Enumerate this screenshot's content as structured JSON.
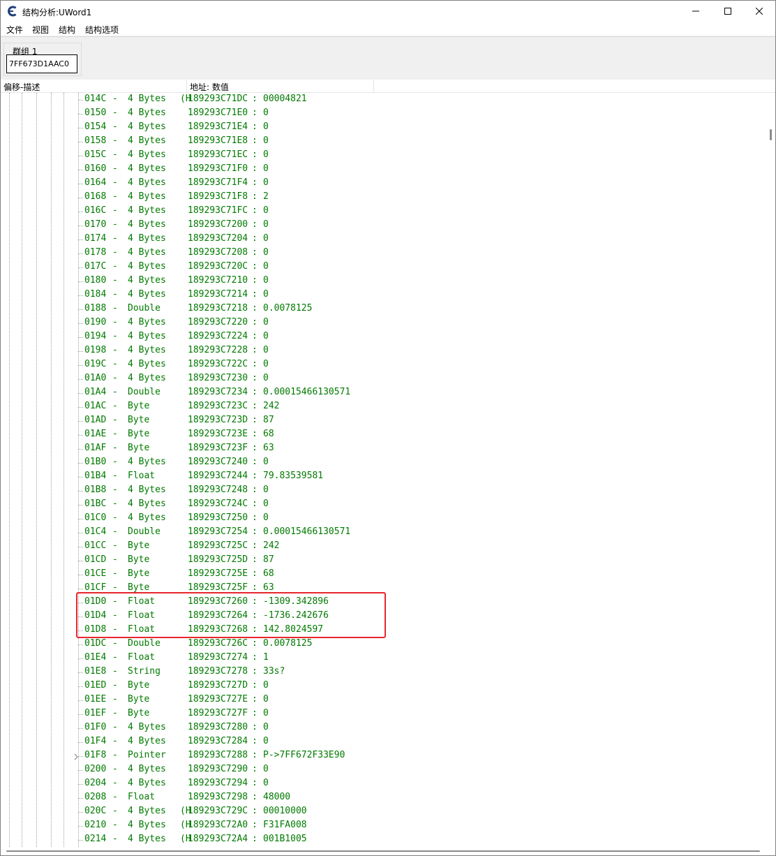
{
  "window": {
    "title": "结构分析:UWord1"
  },
  "menu": [
    "文件",
    "视图",
    "结构",
    "结构选项"
  ],
  "group": {
    "label": "群组 1",
    "address": "7FF673D1AAC0"
  },
  "header": {
    "col1": "偏移-描述",
    "col2": "地址: 数值"
  },
  "rows": [
    {
      "offset": "014C",
      "type": "4 Bytes",
      "hint": "(H",
      "address": "189293C71DC",
      "value": "00004821"
    },
    {
      "offset": "0150",
      "type": "4 Bytes",
      "hint": "",
      "address": "189293C71E0",
      "value": "0"
    },
    {
      "offset": "0154",
      "type": "4 Bytes",
      "hint": "",
      "address": "189293C71E4",
      "value": "0"
    },
    {
      "offset": "0158",
      "type": "4 Bytes",
      "hint": "",
      "address": "189293C71E8",
      "value": "0"
    },
    {
      "offset": "015C",
      "type": "4 Bytes",
      "hint": "",
      "address": "189293C71EC",
      "value": "0"
    },
    {
      "offset": "0160",
      "type": "4 Bytes",
      "hint": "",
      "address": "189293C71F0",
      "value": "0"
    },
    {
      "offset": "0164",
      "type": "4 Bytes",
      "hint": "",
      "address": "189293C71F4",
      "value": "0"
    },
    {
      "offset": "0168",
      "type": "4 Bytes",
      "hint": "",
      "address": "189293C71F8",
      "value": "2"
    },
    {
      "offset": "016C",
      "type": "4 Bytes",
      "hint": "",
      "address": "189293C71FC",
      "value": "0"
    },
    {
      "offset": "0170",
      "type": "4 Bytes",
      "hint": "",
      "address": "189293C7200",
      "value": "0"
    },
    {
      "offset": "0174",
      "type": "4 Bytes",
      "hint": "",
      "address": "189293C7204",
      "value": "0"
    },
    {
      "offset": "0178",
      "type": "4 Bytes",
      "hint": "",
      "address": "189293C7208",
      "value": "0"
    },
    {
      "offset": "017C",
      "type": "4 Bytes",
      "hint": "",
      "address": "189293C720C",
      "value": "0"
    },
    {
      "offset": "0180",
      "type": "4 Bytes",
      "hint": "",
      "address": "189293C7210",
      "value": "0"
    },
    {
      "offset": "0184",
      "type": "4 Bytes",
      "hint": "",
      "address": "189293C7214",
      "value": "0"
    },
    {
      "offset": "0188",
      "type": "Double",
      "hint": "",
      "address": "189293C7218",
      "value": "0.0078125"
    },
    {
      "offset": "0190",
      "type": "4 Bytes",
      "hint": "",
      "address": "189293C7220",
      "value": "0"
    },
    {
      "offset": "0194",
      "type": "4 Bytes",
      "hint": "",
      "address": "189293C7224",
      "value": "0"
    },
    {
      "offset": "0198",
      "type": "4 Bytes",
      "hint": "",
      "address": "189293C7228",
      "value": "0"
    },
    {
      "offset": "019C",
      "type": "4 Bytes",
      "hint": "",
      "address": "189293C722C",
      "value": "0"
    },
    {
      "offset": "01A0",
      "type": "4 Bytes",
      "hint": "",
      "address": "189293C7230",
      "value": "0"
    },
    {
      "offset": "01A4",
      "type": "Double",
      "hint": "",
      "address": "189293C7234",
      "value": "0.00015466130571"
    },
    {
      "offset": "01AC",
      "type": "Byte",
      "hint": "",
      "address": "189293C723C",
      "value": "242"
    },
    {
      "offset": "01AD",
      "type": "Byte",
      "hint": "",
      "address": "189293C723D",
      "value": "87"
    },
    {
      "offset": "01AE",
      "type": "Byte",
      "hint": "",
      "address": "189293C723E",
      "value": "68"
    },
    {
      "offset": "01AF",
      "type": "Byte",
      "hint": "",
      "address": "189293C723F",
      "value": "63"
    },
    {
      "offset": "01B0",
      "type": "4 Bytes",
      "hint": "",
      "address": "189293C7240",
      "value": "0"
    },
    {
      "offset": "01B4",
      "type": "Float",
      "hint": "",
      "address": "189293C7244",
      "value": "79.83539581"
    },
    {
      "offset": "01B8",
      "type": "4 Bytes",
      "hint": "",
      "address": "189293C7248",
      "value": "0"
    },
    {
      "offset": "01BC",
      "type": "4 Bytes",
      "hint": "",
      "address": "189293C724C",
      "value": "0"
    },
    {
      "offset": "01C0",
      "type": "4 Bytes",
      "hint": "",
      "address": "189293C7250",
      "value": "0"
    },
    {
      "offset": "01C4",
      "type": "Double",
      "hint": "",
      "address": "189293C7254",
      "value": "0.00015466130571"
    },
    {
      "offset": "01CC",
      "type": "Byte",
      "hint": "",
      "address": "189293C725C",
      "value": "242"
    },
    {
      "offset": "01CD",
      "type": "Byte",
      "hint": "",
      "address": "189293C725D",
      "value": "87"
    },
    {
      "offset": "01CE",
      "type": "Byte",
      "hint": "",
      "address": "189293C725E",
      "value": "68"
    },
    {
      "offset": "01CF",
      "type": "Byte",
      "hint": "",
      "address": "189293C725F",
      "value": "63"
    },
    {
      "offset": "01D0",
      "type": "Float",
      "hint": "",
      "address": "189293C7260",
      "value": "-1309.342896"
    },
    {
      "offset": "01D4",
      "type": "Float",
      "hint": "",
      "address": "189293C7264",
      "value": "-1736.242676"
    },
    {
      "offset": "01D8",
      "type": "Float",
      "hint": "",
      "address": "189293C7268",
      "value": "142.8024597"
    },
    {
      "offset": "01DC",
      "type": "Double",
      "hint": "",
      "address": "189293C726C",
      "value": "0.0078125"
    },
    {
      "offset": "01E4",
      "type": "Float",
      "hint": "",
      "address": "189293C7274",
      "value": "1"
    },
    {
      "offset": "01E8",
      "type": "String",
      "hint": "",
      "address": "189293C7278",
      "value": "33s?"
    },
    {
      "offset": "01ED",
      "type": "Byte",
      "hint": "",
      "address": "189293C727D",
      "value": "0"
    },
    {
      "offset": "01EE",
      "type": "Byte",
      "hint": "",
      "address": "189293C727E",
      "value": "0"
    },
    {
      "offset": "01EF",
      "type": "Byte",
      "hint": "",
      "address": "189293C727F",
      "value": "0"
    },
    {
      "offset": "01F0",
      "type": "4 Bytes",
      "hint": "",
      "address": "189293C7280",
      "value": "0"
    },
    {
      "offset": "01F4",
      "type": "4 Bytes",
      "hint": "",
      "address": "189293C7284",
      "value": "0"
    },
    {
      "offset": "01F8",
      "type": "Pointer",
      "hint": "",
      "address": "189293C7288",
      "value": "P->7FF672F33E90",
      "expandable": true
    },
    {
      "offset": "0200",
      "type": "4 Bytes",
      "hint": "",
      "address": "189293C7290",
      "value": "0"
    },
    {
      "offset": "0204",
      "type": "4 Bytes",
      "hint": "",
      "address": "189293C7294",
      "value": "0"
    },
    {
      "offset": "0208",
      "type": "Float",
      "hint": "",
      "address": "189293C7298",
      "value": "48000"
    },
    {
      "offset": "020C",
      "type": "4 Bytes",
      "hint": "(H",
      "address": "189293C729C",
      "value": "00010000"
    },
    {
      "offset": "0210",
      "type": "4 Bytes",
      "hint": "(H",
      "address": "189293C72A0",
      "value": "F31FA008"
    },
    {
      "offset": "0214",
      "type": "4 Bytes",
      "hint": "(H",
      "address": "189293C72A4",
      "value": "001B1005"
    }
  ],
  "colors": {
    "value_text": "#007a00",
    "highlight_border": "#e8262d"
  }
}
